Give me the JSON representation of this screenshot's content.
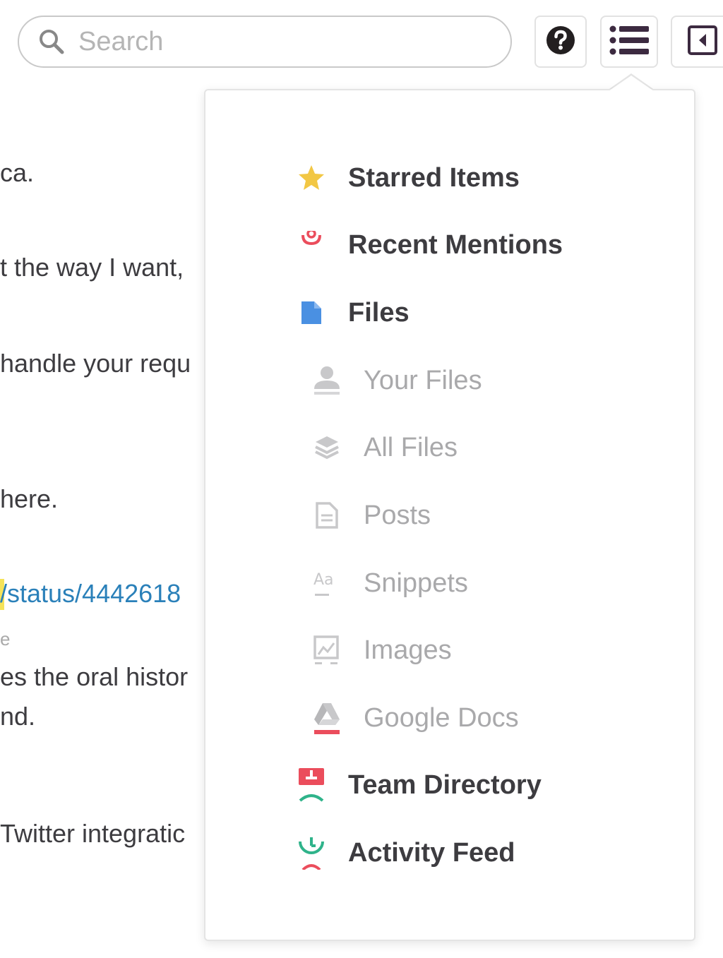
{
  "search": {
    "placeholder": "Search"
  },
  "toolbar": {
    "help_icon": "question-circle-icon",
    "flexpane_icon": "list-icon",
    "sidebar_icon": "sidebar-toggle-icon"
  },
  "messages": [
    {
      "text": "ca."
    },
    {
      "text": "t the way I want,"
    },
    {
      "text": "handle your requ"
    },
    {
      "text": "here."
    },
    {
      "text": "/status/4442618"
    },
    {
      "text": "e"
    },
    {
      "text": "es the oral histor"
    },
    {
      "text": "nd."
    },
    {
      "text": "Twitter integratic"
    }
  ],
  "menu": {
    "starred": {
      "label": "Starred Items",
      "icon": "star-icon",
      "color": "#f2c744"
    },
    "mentions": {
      "label": "Recent Mentions",
      "icon": "at-sign-icon",
      "color": "#eb4d5c"
    },
    "files": {
      "label": "Files",
      "icon": "file-icon",
      "color": "#4a90e2"
    },
    "your_files": {
      "label": "Your Files",
      "icon": "user-icon"
    },
    "all_files": {
      "label": "All Files",
      "icon": "layers-icon"
    },
    "posts": {
      "label": "Posts",
      "icon": "document-icon"
    },
    "snippets": {
      "label": "Snippets",
      "icon": "text-aa-icon"
    },
    "images": {
      "label": "Images",
      "icon": "image-icon"
    },
    "google_docs": {
      "label": "Google Docs",
      "icon": "google-drive-icon"
    },
    "team_directory": {
      "label": "Team Directory",
      "icon": "directory-icon",
      "color": "#eb4d5c"
    },
    "activity_feed": {
      "label": "Activity Feed",
      "icon": "activity-clock-icon",
      "color": "#2fb38a"
    }
  }
}
